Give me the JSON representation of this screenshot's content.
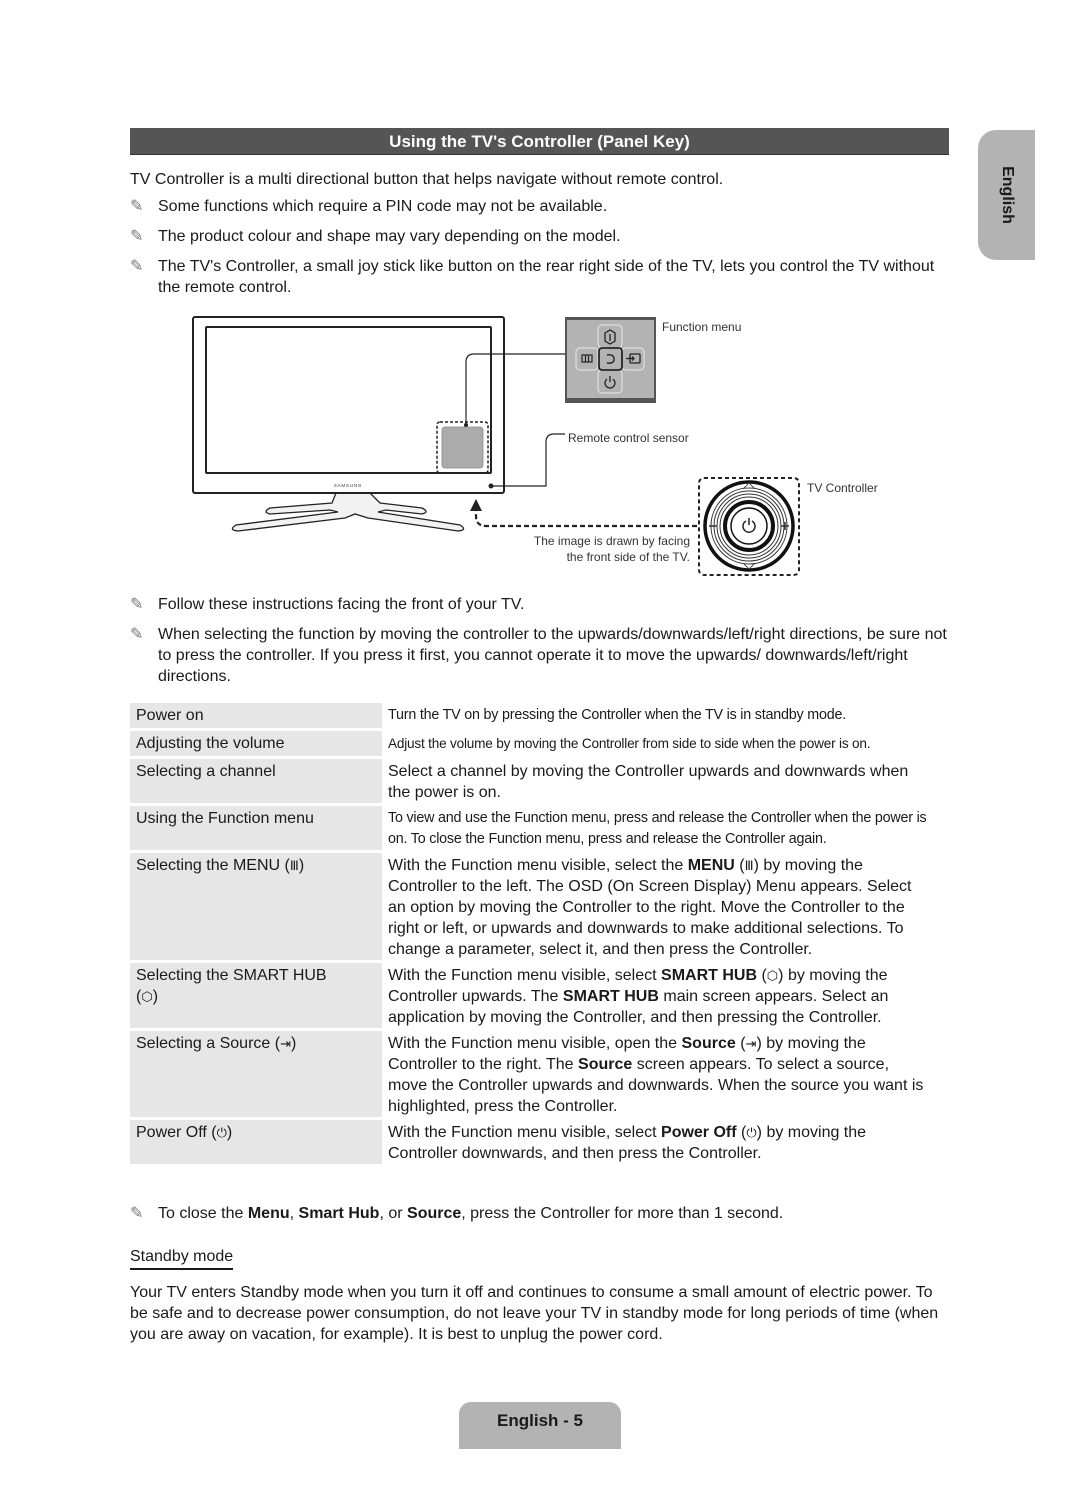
{
  "page": {
    "title": "Using the TV's Controller (Panel Key)",
    "language_tab": "English",
    "footer": "English - 5"
  },
  "intro": {
    "lead": "TV Controller is a multi directional button that helps navigate without remote control.",
    "notes": [
      "Some functions which require a PIN code may not be available.",
      "The product colour and shape may vary depending on the model.",
      "The TV's Controller, a small joy stick like button on the rear right side of the TV, lets you control the TV without the remote control."
    ]
  },
  "diagram": {
    "brand": "SAMSUNG",
    "labels": {
      "function_menu": "Function menu",
      "remote_sensor": "Remote control sensor",
      "tv_controller": "TV Controller",
      "facing_note_1": "The image is drawn by facing",
      "facing_note_2": "the front side of the TV."
    },
    "function_menu_icons": [
      "smart-hub-icon",
      "menu-icon",
      "return-icon",
      "source-icon",
      "power-icon"
    ]
  },
  "instructions": {
    "notes": [
      "Follow these instructions facing the front of your TV.",
      "When selecting the function by moving the controller to the upwards/downwards/left/right directions, be sure not to press the controller. If you press it first, you cannot operate it to move the upwards/ downwards/left/right directions."
    ]
  },
  "table": {
    "rows": [
      {
        "label": "Power on",
        "desc": "Turn the TV on by pressing the Controller when the TV is in standby mode."
      },
      {
        "label": "Adjusting the volume",
        "desc": "Adjust the volume by moving the Controller from side to side when the power is on."
      },
      {
        "label": "Selecting a channel",
        "desc": "Select a channel by moving the Controller upwards and downwards when the power is on."
      },
      {
        "label": "Using the Function menu",
        "desc": "To view and use the Function menu, press and release the Controller when the power is on. To close the Function menu, press and release the Controller again."
      },
      {
        "label": "Selecting the MENU",
        "icon": "Ⅲ",
        "desc_pre": "With the Function menu visible, select the",
        "desc_bold": "MENU",
        "desc_post": "by moving the Controller to the left. The OSD (On Screen Display) Menu appears. Select an option by moving the Controller to the right. Move the Controller to the right or left, or upwards and downwards to make additional selections. To change a parameter, select it, and then press the Controller."
      },
      {
        "label": "Selecting the SMART HUB",
        "icon": "⬡",
        "desc_pre": "With the Function menu visible, select",
        "desc_bold": "SMART HUB",
        "desc_mid": "by moving the Controller upwards. The",
        "desc_bold2": "SMART HUB",
        "desc_post": "main screen appears. Select an application by moving the Controller, and then pressing the Controller."
      },
      {
        "label": "Selecting a Source",
        "icon": "⇥",
        "desc_pre": "With the Function menu visible, open the",
        "desc_bold": "Source",
        "desc_mid": "by moving the Controller to the right. The",
        "desc_bold2": "Source",
        "desc_post": "screen appears. To select a source, move the Controller upwards and downwards. When the source you want is highlighted, press the Controller."
      },
      {
        "label": "Power Off",
        "icon": "⏻",
        "desc_pre": "With the Function menu visible, select",
        "desc_bold": "Power Off",
        "desc_post": "by moving the Controller downwards, and then press the Controller."
      }
    ]
  },
  "closing_note": {
    "pre": "To close the",
    "b1": "Menu",
    "sep1": ",",
    "b2": "Smart Hub",
    "sep2": ", or",
    "b3": "Source",
    "post": ", press the Controller for more than 1 second."
  },
  "standby": {
    "heading": "Standby mode",
    "body": "Your TV enters Standby mode when you turn it off and continues to consume a small amount of electric power. To be safe and to decrease power consumption, do not leave your TV in standby mode for long periods of time (when you are away on vacation, for example). It is best to unplug the power cord."
  },
  "icons": {
    "note": "✎",
    "paren_open": "(",
    "paren_close": ")"
  }
}
